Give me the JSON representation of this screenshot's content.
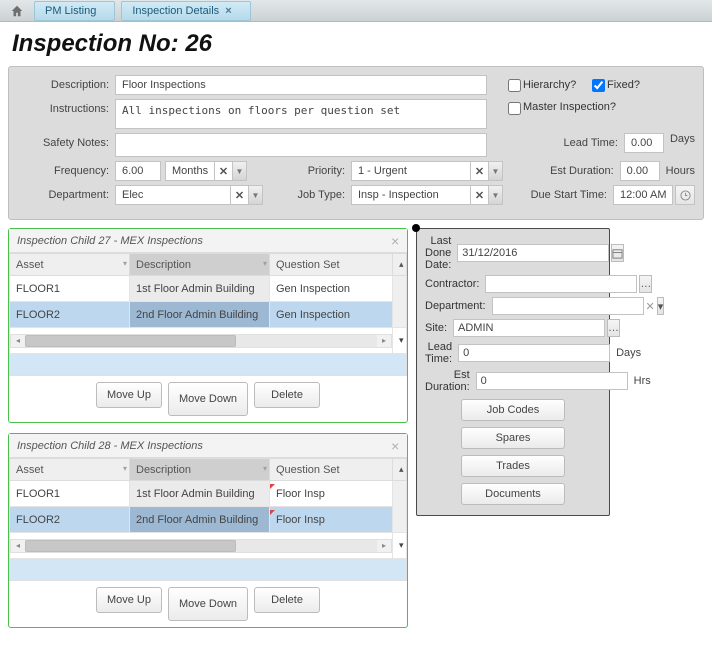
{
  "breadcrumb": {
    "pm_listing": "PM Listing",
    "inspection_details": "Inspection Details"
  },
  "page_title": "Inspection No: 26",
  "form": {
    "labels": {
      "description": "Description:",
      "instructions": "Instructions:",
      "safety_notes": "Safety Notes:",
      "frequency": "Frequency:",
      "department": "Department:",
      "priority": "Priority:",
      "job_type": "Job Type:",
      "hierarchy": "Hierarchy?",
      "fixed": "Fixed?",
      "master_inspection": "Master Inspection?",
      "lead_time": "Lead Time:",
      "est_duration": "Est Duration:",
      "due_start_time": "Due Start Time:"
    },
    "description": "Floor Inspections",
    "instructions": "All inspections on floors per question set",
    "safety_notes": "",
    "hierarchy": false,
    "fixed": true,
    "master_inspection": false,
    "frequency_value": "6.00",
    "frequency_unit": "Months",
    "department": "Elec",
    "priority": "1 - Urgent",
    "job_type": "Insp - Inspection",
    "lead_time_value": "0.00",
    "lead_time_unit": "Days",
    "est_duration_value": "0.00",
    "est_duration_unit": "Hours",
    "due_start_time": "12:00 AM"
  },
  "grid_actions": {
    "move_up": "Move Up",
    "move_down": "Move Down",
    "delete": "Delete"
  },
  "grid_cols": {
    "asset": "Asset",
    "description": "Description",
    "question_set": "Question Set"
  },
  "child27": {
    "title": "Inspection Child 27 - MEX Inspections",
    "rows": [
      {
        "asset": "FLOOR1",
        "desc": "1st Floor Admin Building",
        "qset": "Gen Inspection"
      },
      {
        "asset": "FLOOR2",
        "desc": "2nd Floor Admin Building",
        "qset": "Gen Inspection"
      }
    ]
  },
  "child28": {
    "title": "Inspection Child 28 - MEX Inspections",
    "rows": [
      {
        "asset": "FLOOR1",
        "desc": "1st Floor Admin Building",
        "qset": "Floor Insp"
      },
      {
        "asset": "FLOOR2",
        "desc": "2nd Floor Admin Building",
        "qset": "Floor Insp"
      }
    ]
  },
  "side": {
    "labels": {
      "last_done_date": "Last Done Date:",
      "contractor": "Contractor:",
      "department": "Department:",
      "site": "Site:",
      "lead_time": "Lead Time:",
      "est_duration": "Est Duration:"
    },
    "last_done_date": "31/12/2016",
    "contractor": "",
    "department": "",
    "site": "ADMIN",
    "lead_time_value": "0",
    "lead_time_unit": "Days",
    "est_duration_value": "0",
    "est_duration_unit": "Hrs",
    "buttons": {
      "job_codes": "Job Codes",
      "spares": "Spares",
      "trades": "Trades",
      "documents": "Documents"
    }
  }
}
